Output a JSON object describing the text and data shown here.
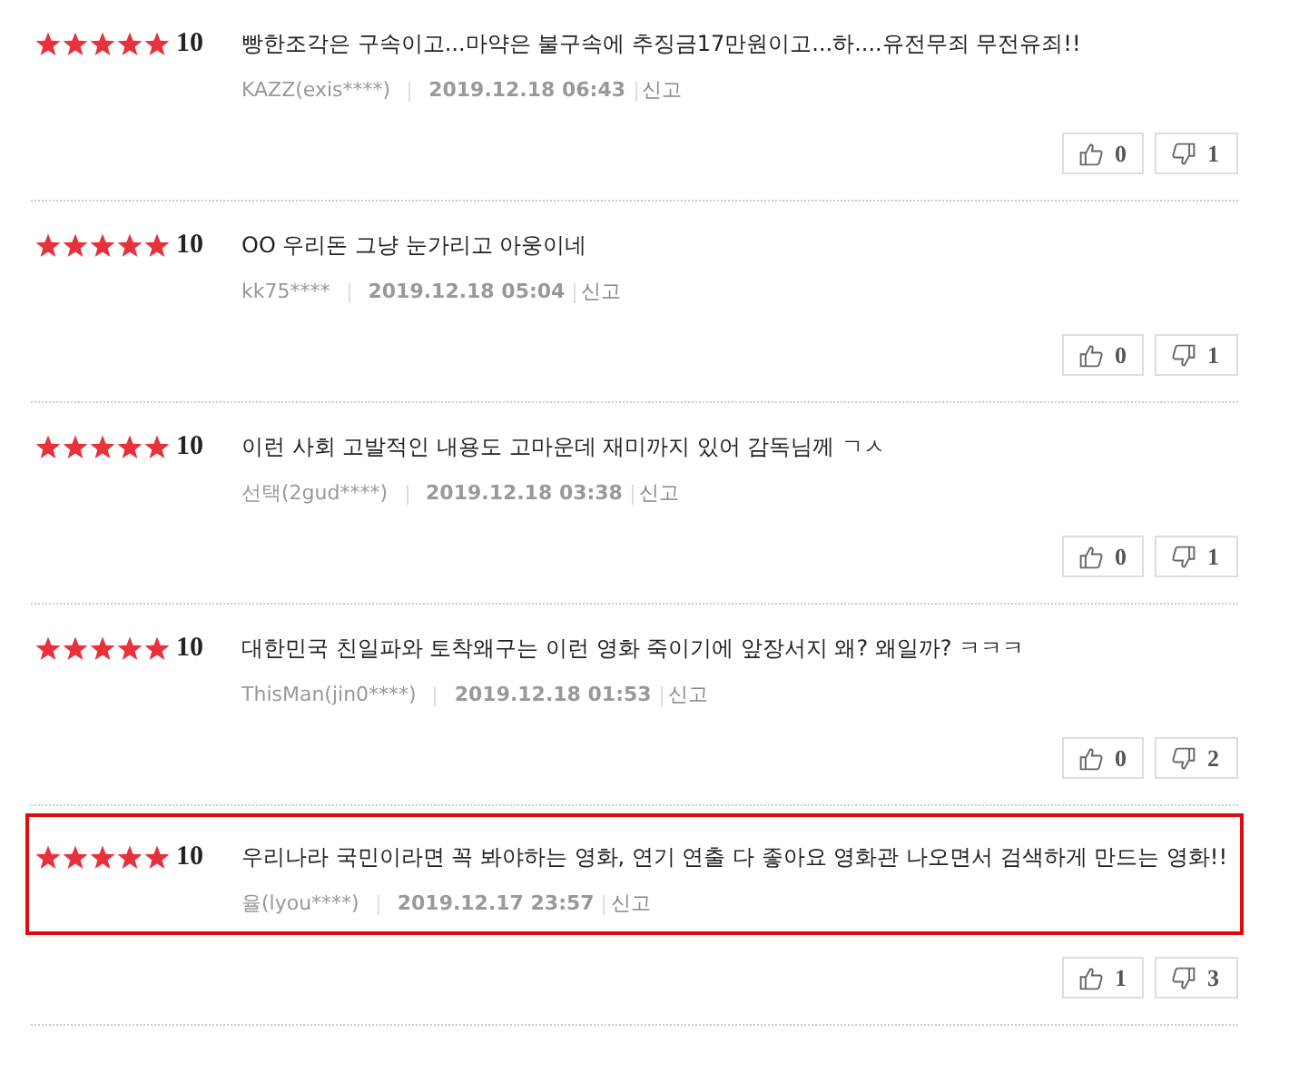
{
  "reviews": [
    {
      "stars": 5,
      "score": "10",
      "text": "빵한조각은 구속이고...마약은 불구속에 추징금17만원이고...하....유전무죄 무전유죄!!",
      "author": "KAZZ(exis****)",
      "date": "2019.12.18 06:43",
      "report": "신고",
      "likes": "0",
      "dislikes": "1",
      "highlighted": false
    },
    {
      "stars": 5,
      "score": "10",
      "text": "OO 우리돈 그냥 눈가리고 아웅이네",
      "author": "kk75****",
      "date": "2019.12.18 05:04",
      "report": "신고",
      "likes": "0",
      "dislikes": "1",
      "highlighted": false
    },
    {
      "stars": 5,
      "score": "10",
      "text": "이런 사회 고발적인 내용도 고마운데 재미까지 있어 감독님께 ㄱㅅ",
      "author": "선택(2gud****)",
      "date": "2019.12.18 03:38",
      "report": "신고",
      "likes": "0",
      "dislikes": "1",
      "highlighted": false
    },
    {
      "stars": 5,
      "score": "10",
      "text": "대한민국 친일파와 토착왜구는 이런 영화 죽이기에 앞장서지 왜? 왜일까? ㅋㅋㅋ",
      "author": "ThisMan(jin0****)",
      "date": "2019.12.18 01:53",
      "report": "신고",
      "likes": "0",
      "dislikes": "2",
      "highlighted": false
    },
    {
      "stars": 5,
      "score": "10",
      "text": "우리나라 국민이라면 꼭 봐야하는 영화, 연기 연출 다 좋아요 영화관 나오면서 검색하게 만드는 영화!!",
      "author": "율(lyou****)",
      "date": "2019.12.17 23:57",
      "report": "신고",
      "likes": "1",
      "dislikes": "3",
      "highlighted": true
    }
  ]
}
